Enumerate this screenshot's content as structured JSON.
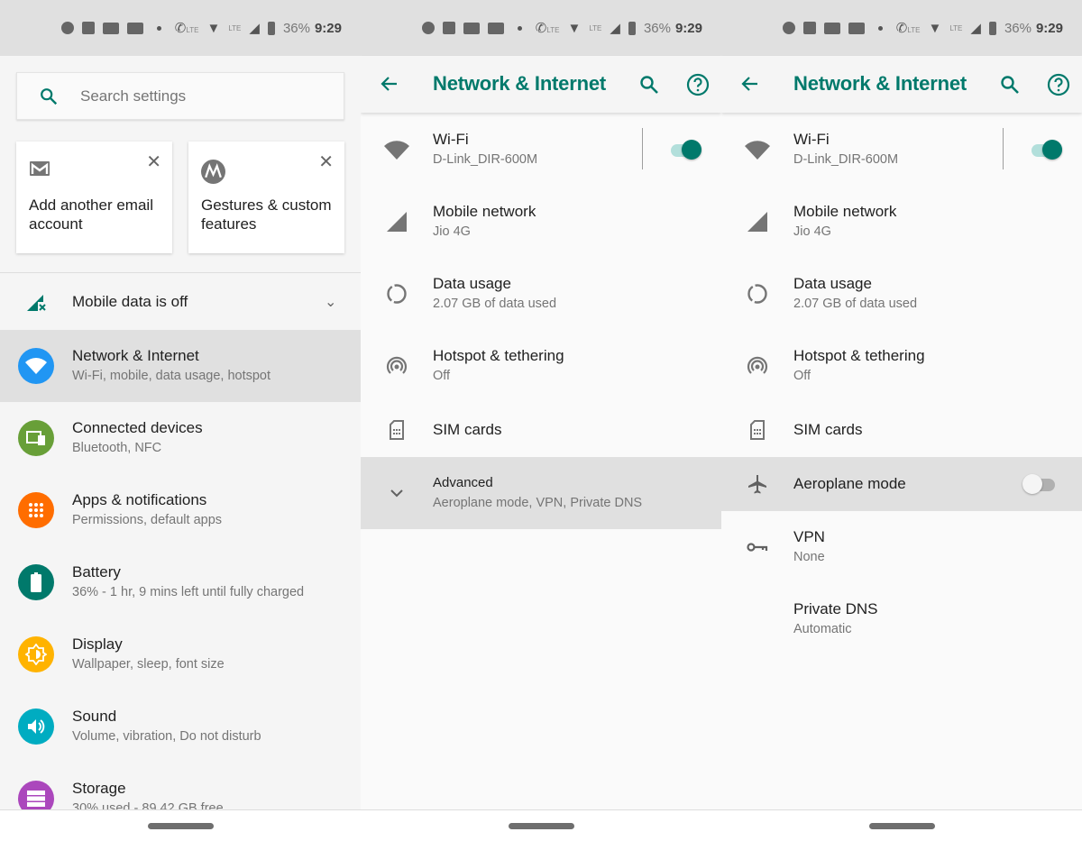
{
  "status_bar": {
    "battery": "36%",
    "time": "9:29",
    "lte": "LTE",
    "icons": [
      "facebook-icon",
      "calendar-icon",
      "news-icon",
      "app-icon",
      "dot-icon",
      "volte-call-icon",
      "wifi-icon",
      "signal-icon",
      "battery-charging-icon"
    ]
  },
  "colors": {
    "accent": "#00796b",
    "network": "#2196f3",
    "connected": "#689f38",
    "apps": "#ff6d00",
    "battery": "#00796b",
    "display": "#ffb300",
    "sound": "#00acc1",
    "storage": "#ab47bc",
    "highlight": "#e0e0e0"
  },
  "settings": {
    "search_placeholder": "Search settings",
    "suggestions": [
      {
        "title": "Add another email account",
        "icon": "gmail-icon"
      },
      {
        "title": "Gestures & custom features",
        "icon": "motorola-icon"
      }
    ],
    "mobile_data_banner": "Mobile data is off",
    "items": [
      {
        "title": "Network & Internet",
        "subtitle": "Wi-Fi, mobile, data usage, hotspot",
        "icon": "wifi-icon",
        "selected": true
      },
      {
        "title": "Connected devices",
        "subtitle": "Bluetooth, NFC",
        "icon": "devices-icon"
      },
      {
        "title": "Apps & notifications",
        "subtitle": "Permissions, default apps",
        "icon": "apps-grid-icon"
      },
      {
        "title": "Battery",
        "subtitle": "36% - 1 hr, 9 mins left until fully charged",
        "icon": "battery-icon"
      },
      {
        "title": "Display",
        "subtitle": "Wallpaper, sleep, font size",
        "icon": "brightness-icon"
      },
      {
        "title": "Sound",
        "subtitle": "Volume, vibration, Do not disturb",
        "icon": "volume-icon"
      },
      {
        "title": "Storage",
        "subtitle": "30% used - 89.42 GB free",
        "icon": "storage-icon"
      }
    ]
  },
  "network": {
    "title": "Network & Internet",
    "wifi": {
      "title": "Wi-Fi",
      "subtitle": "D-Link_DIR-600M",
      "enabled": true
    },
    "mobile": {
      "title": "Mobile network",
      "subtitle": "Jio 4G"
    },
    "data_usage": {
      "title": "Data usage",
      "subtitle": "2.07 GB of data used"
    },
    "hotspot": {
      "title": "Hotspot & tethering",
      "subtitle": "Off"
    },
    "sim": {
      "title": "SIM cards"
    },
    "advanced": {
      "title": "Advanced",
      "subtitle": "Aeroplane mode, VPN, Private DNS"
    },
    "aeroplane": {
      "title": "Aeroplane mode",
      "enabled": false
    },
    "vpn": {
      "title": "VPN",
      "subtitle": "None"
    },
    "dns": {
      "title": "Private DNS",
      "subtitle": "Automatic"
    }
  }
}
